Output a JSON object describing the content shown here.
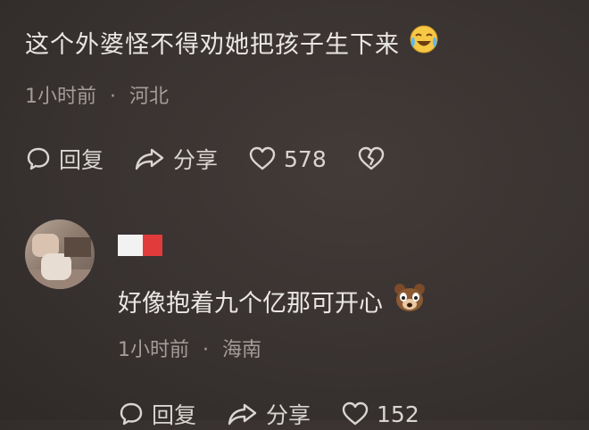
{
  "comment1": {
    "text": "这个外婆怪不得劝她把孩子生下来",
    "emoji": "crying-laughing-emoji",
    "time": "1小时前",
    "location": "河北",
    "reply_label": "回复",
    "share_label": "分享",
    "like_count": "578"
  },
  "comment2": {
    "text": "好像抱着九个亿那可开心",
    "emoji": "bear-emoji",
    "time": "1小时前",
    "location": "海南",
    "reply_label": "回复",
    "share_label": "分享",
    "like_count": "152"
  },
  "separator": "·",
  "colors": {
    "username_red": "#e23b3b",
    "muted": "#a49d98"
  }
}
